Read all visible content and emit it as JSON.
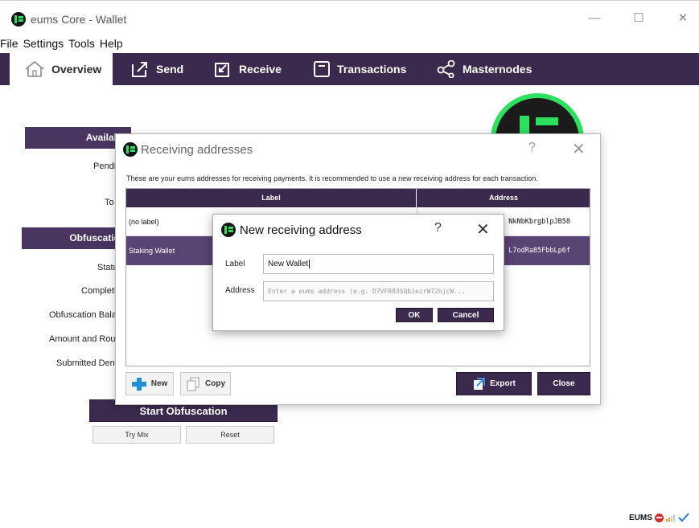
{
  "window": {
    "title": "eums Core - Wallet",
    "minimize": "—",
    "maximize": "☐",
    "close": "✕"
  },
  "menu": [
    "File",
    "Settings",
    "Tools",
    "Help"
  ],
  "tabs": [
    {
      "label": "Overview",
      "icon": "home-icon",
      "active": true
    },
    {
      "label": "Send",
      "icon": "send-icon"
    },
    {
      "label": "Receive",
      "icon": "receive-icon"
    },
    {
      "label": "Transactions",
      "icon": "transactions-icon"
    },
    {
      "label": "Masternodes",
      "icon": "share-network-icon"
    }
  ],
  "overview": {
    "available_banner": "Availab",
    "pending_label": "Pendi",
    "total_label": "To",
    "obfuscation_banner": "Obfuscatio",
    "status_label": "Statu",
    "completion_label": "Completio",
    "balance_label": "Obfuscation Balanc",
    "rounds_label": "Amount and Round",
    "denoms_label": "Submitted Denor",
    "start_button": "Start Obfuscation",
    "try_mix_button": "Try Mix",
    "reset_button": "Reset"
  },
  "receiving_dialog": {
    "title": "Receiving addresses",
    "help": "?",
    "close": "✕",
    "description": "These are your eums addresses for receiving payments. It is recommended to use a new receiving address for each transaction.",
    "columns": {
      "label": "Label",
      "address": "Address"
    },
    "rows": [
      {
        "label": "(no label)",
        "address": "NkNbKbrgblpJB58"
      },
      {
        "label": "Staking Wallet",
        "address": "L7odRa85FbbLp6f"
      }
    ],
    "buttons": {
      "new": "New",
      "copy": "Copy",
      "export": "Export",
      "close": "Close"
    }
  },
  "new_address_dialog": {
    "title": "New receiving address",
    "help": "?",
    "close": "✕",
    "label_caption": "Label",
    "label_value": "New Wallet",
    "address_caption": "Address",
    "address_placeholder": "Enter a eums address (e.g. D7VFR83SQbiezrW72hjcW...",
    "ok": "OK",
    "cancel": "Cancel"
  },
  "tray": {
    "text": "EUMS"
  },
  "colors": {
    "accent": "#3b2a4e",
    "selected_row": "#5a4474",
    "logo_green": "#2ee05f"
  }
}
